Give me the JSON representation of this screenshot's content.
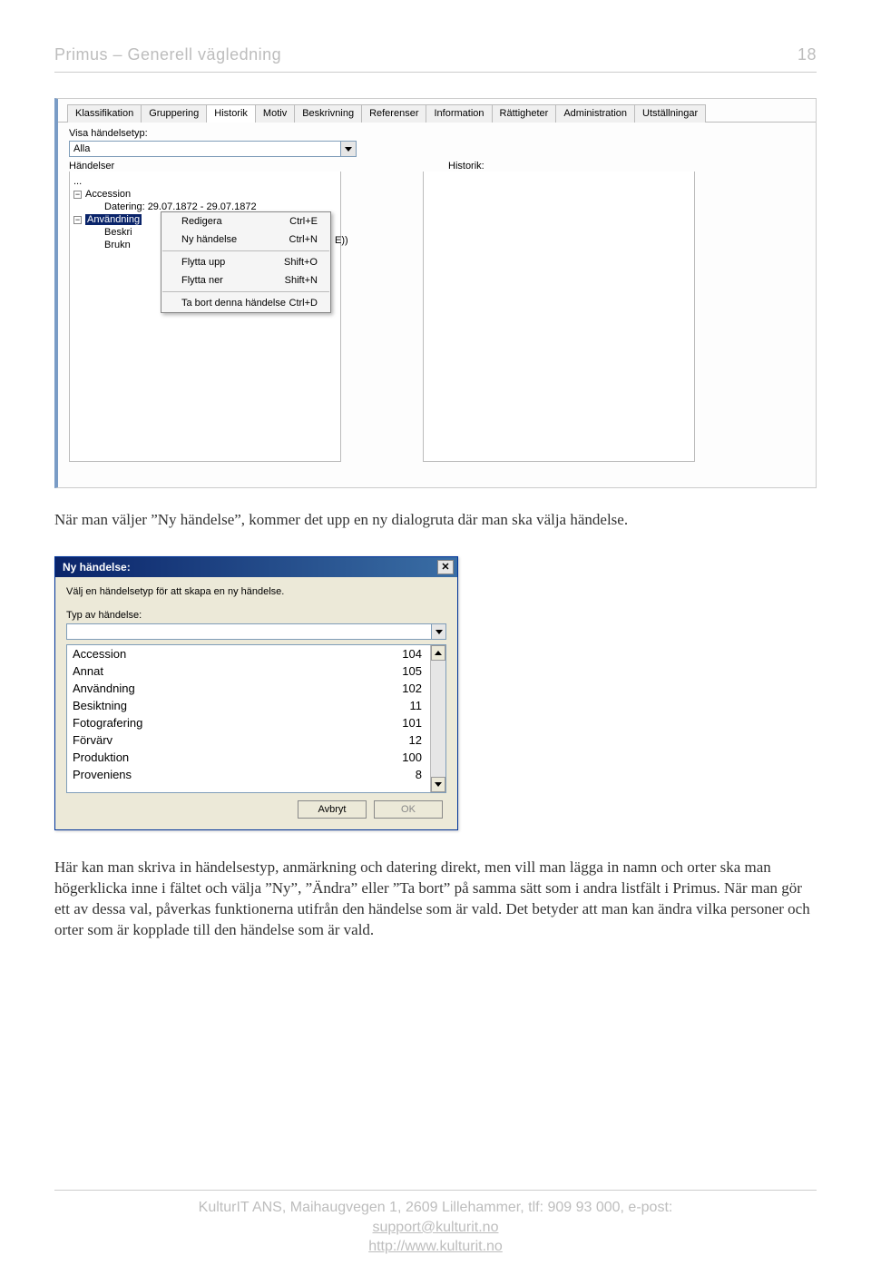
{
  "header": {
    "title": "Primus – Generell vägledning",
    "page_no": "18"
  },
  "tabs": [
    "Klassifikation",
    "Gruppering",
    "Historik",
    "Motiv",
    "Beskrivning",
    "Referenser",
    "Information",
    "Rättigheter",
    "Administration",
    "Utställningar"
  ],
  "panel": {
    "show_label": "Visa händelsetyp:",
    "show_value": "Alla",
    "events_label": "Händelser",
    "hist_label": "Historik:",
    "ej_hint": "E))",
    "tree": {
      "root": "...",
      "n1": "Accession",
      "n1c": "Datering: 29.07.1872 - 29.07.1872",
      "n2": "Användning",
      "n2c1": "Beskri",
      "n2c2": "Brukn"
    },
    "ctx": {
      "edit": "Redigera",
      "edit_k": "Ctrl+E",
      "new": "Ny händelse",
      "new_k": "Ctrl+N",
      "up": "Flytta upp",
      "up_k": "Shift+O",
      "down": "Flytta ner",
      "down_k": "Shift+N",
      "del": "Ta bort denna händelse",
      "del_k": "Ctrl+D"
    }
  },
  "para1": "När man väljer ”Ny händelse”, kommer det upp en ny dialogruta där man ska välja händelse.",
  "dlg": {
    "title": "Ny händelse:",
    "instr": "Välj en händelsetyp för att skapa en ny händelse.",
    "sub": "Typ av händelse:",
    "input": "",
    "items": [
      {
        "n": "Accession",
        "v": "104"
      },
      {
        "n": "Annat",
        "v": "105"
      },
      {
        "n": "Användning",
        "v": "102"
      },
      {
        "n": "Besiktning",
        "v": "11"
      },
      {
        "n": "Fotografering",
        "v": "101"
      },
      {
        "n": "Förvärv",
        "v": "12"
      },
      {
        "n": "Produktion",
        "v": "100"
      },
      {
        "n": "Proveniens",
        "v": "8"
      }
    ],
    "cancel": "Avbryt",
    "ok": "OK"
  },
  "para2": "Här kan man skriva in händelsestyp, anmärkning och datering direkt, men vill man lägga in namn och orter ska man högerklicka inne i fältet och välja ”Ny”, ”Ändra” eller ”Ta bort” på samma sätt som i andra listfält i Primus. När man gör ett av dessa val, påverkas funktionerna utifrån den händelse som är vald. Det betyder att man kan ändra vilka personer och orter som är kopplade till den händelse som är vald.",
  "footer": {
    "l1": "KulturIT ANS, Maihaugvegen 1, 2609 Lillehammer, tlf: 909 93 000, e-post:",
    "l2": "support@kulturit.no",
    "l3": "http://www.kulturit.no"
  }
}
